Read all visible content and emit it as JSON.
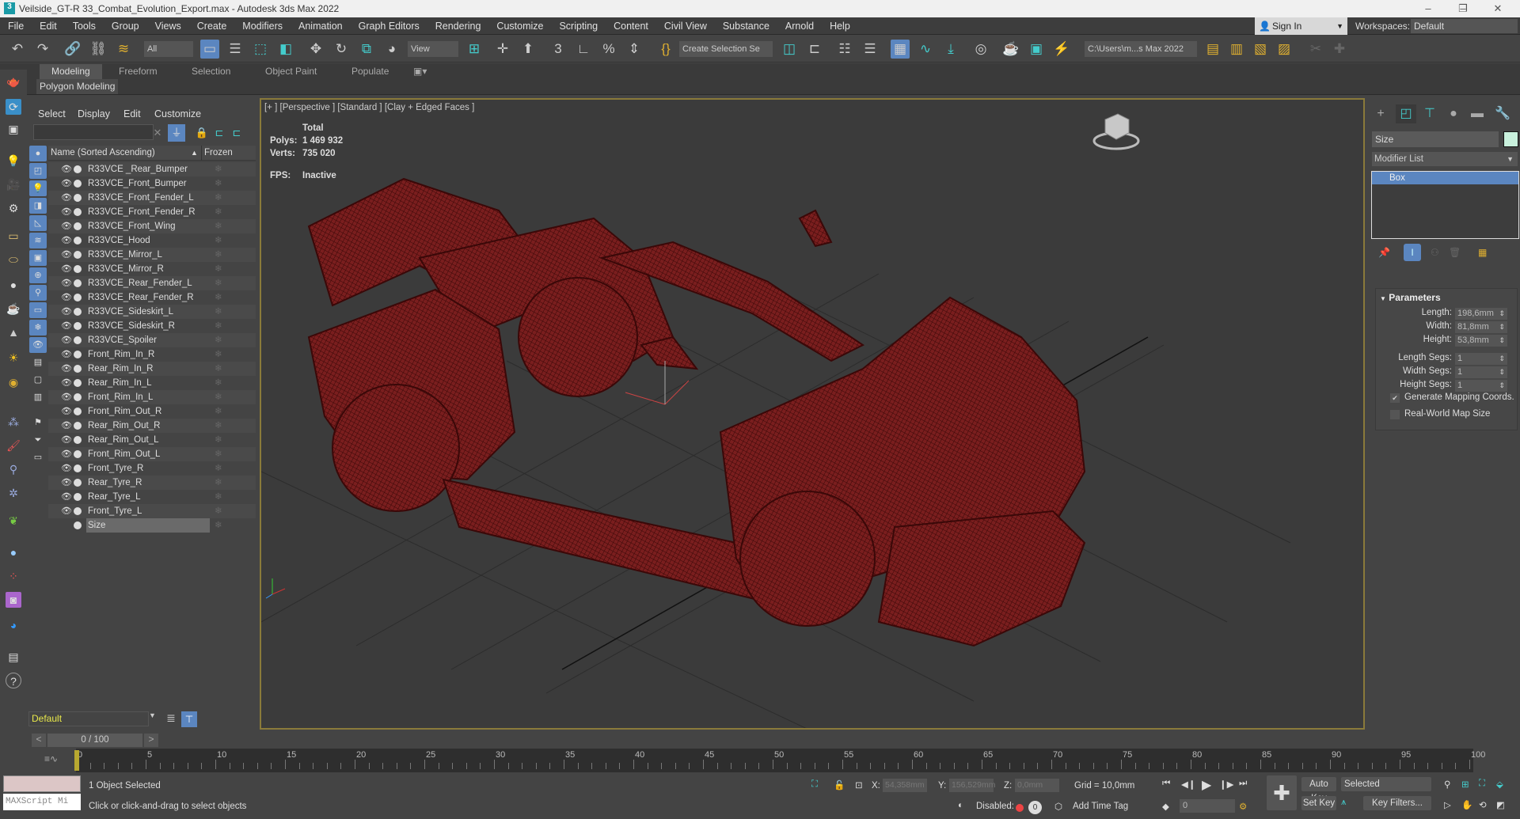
{
  "window": {
    "title": "Veilside_GT-R 33_Combat_Evolution_Export.max - Autodesk 3ds Max 2022",
    "minimize": "–",
    "maximize": "❐",
    "close": "✕"
  },
  "menu": [
    "File",
    "Edit",
    "Tools",
    "Group",
    "Views",
    "Create",
    "Modifiers",
    "Animation",
    "Graph Editors",
    "Rendering",
    "Customize",
    "Scripting",
    "Content",
    "Civil View",
    "Substance",
    "Arnold",
    "Help"
  ],
  "account": {
    "sign_in": "Sign In",
    "workspaces_label": "Workspaces:",
    "workspace": "Default"
  },
  "toolbar": {
    "selection_filter": "All",
    "ref_coord": "View",
    "named_selection": "Create Selection Se",
    "project_path": "C:\\Users\\m...s Max 2022"
  },
  "ribbon": {
    "tabs": [
      "Modeling",
      "Freeform",
      "Selection",
      "Object Paint",
      "Populate"
    ],
    "active": "Modeling",
    "panel": "Polygon Modeling"
  },
  "explorer": {
    "menu": [
      "Select",
      "Display",
      "Edit",
      "Customize"
    ],
    "search_placeholder": "",
    "col_name": "Name (Sorted Ascending)",
    "col_frozen": "Frozen",
    "sort_arrow": "▲",
    "items": [
      "R33VCE _Rear_Bumper",
      "R33VCE_Front_Bumper",
      "R33VCE_Front_Fender_L",
      "R33VCE_Front_Fender_R",
      "R33VCE_Front_Wing",
      "R33VCE_Hood",
      "R33VCE_Mirror_L",
      "R33VCE_Mirror_R",
      "R33VCE_Rear_Fender_L",
      "R33VCE_Rear_Fender_R",
      "R33VCE_Sideskirt_L",
      "R33VCE_Sideskirt_R",
      "R33VCE_Spoiler",
      "Front_Rim_In_R",
      "Rear_Rim_In_R",
      "Rear_Rim_In_L",
      "Front_Rim_In_L",
      "Front_Rim_Out_R",
      "Rear_Rim_Out_R",
      "Rear_Rim_Out_L",
      "Front_Rim_Out_L",
      "Front_Tyre_R",
      "Rear_Tyre_R",
      "Rear_Tyre_L",
      "Front_Tyre_L",
      "Size"
    ],
    "selected": "Size",
    "layer": "Default"
  },
  "viewport": {
    "label": "[+ ] [Perspective ] [Standard ] [Clay + Edged Faces ]",
    "stats": {
      "total": "Total",
      "polys_label": "Polys:",
      "polys": "1 469 932",
      "verts_label": "Verts:",
      "verts": "735 020",
      "fps_label": "FPS:",
      "fps": "Inactive"
    }
  },
  "command_panel": {
    "object_name": "Size",
    "object_color": "#c8f0dc",
    "modifier_list": "Modifier List",
    "stack": [
      "Box"
    ],
    "rollout": "Parameters",
    "params": [
      {
        "label": "Length:",
        "value": "198,6mm"
      },
      {
        "label": "Width:",
        "value": "81,8mm"
      },
      {
        "label": "Height:",
        "value": "53,8mm"
      },
      {
        "label": "Length Segs:",
        "value": "1"
      },
      {
        "label": "Width Segs:",
        "value": "1"
      },
      {
        "label": "Height Segs:",
        "value": "1"
      }
    ],
    "gen_mapping": "Generate Mapping Coords.",
    "gen_mapping_checked": true,
    "real_world": "Real-World Map Size",
    "real_world_checked": false
  },
  "timeline": {
    "slider": "0 / 100",
    "prev": "<",
    "next": ">",
    "ticks": [
      "0",
      "5",
      "10",
      "15",
      "20",
      "25",
      "30",
      "35",
      "40",
      "45",
      "50",
      "55",
      "60",
      "65",
      "70",
      "75",
      "80",
      "85",
      "90",
      "95",
      "100"
    ]
  },
  "status": {
    "maxscript": "MAXScript Mi",
    "selected": "1 Object Selected",
    "prompt": "Click or click-and-drag to select objects",
    "x_label": "X:",
    "x": "54,358mm",
    "y_label": "Y:",
    "y": "156,529mm",
    "z_label": "Z:",
    "z": "0,0mm",
    "grid": "Grid = 10,0mm",
    "disabled": "Disabled:",
    "add_time_tag": "Add Time Tag",
    "frame": "0",
    "auto_key": "Auto Key",
    "set_key": "Set Key",
    "key_mode": "Selected",
    "key_filters": "Key Filters..."
  }
}
